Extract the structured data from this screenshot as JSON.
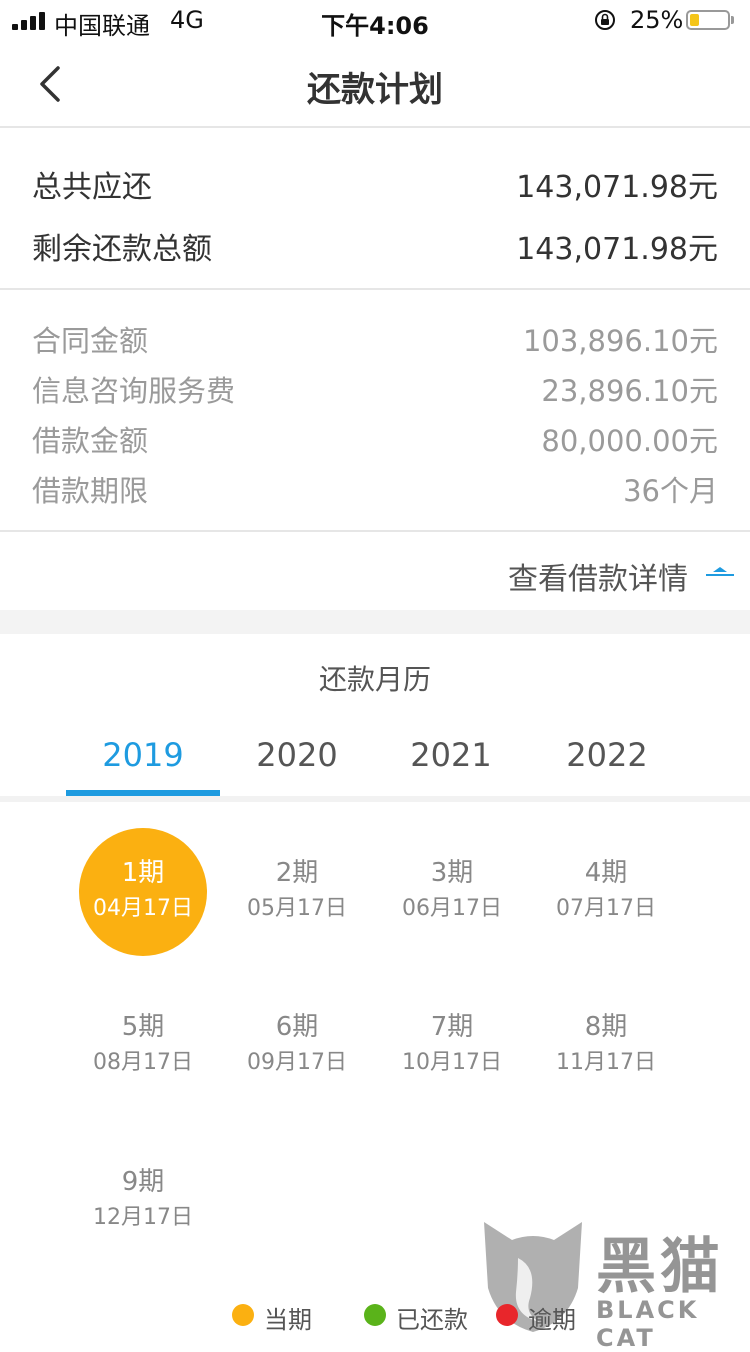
{
  "status_bar": {
    "carrier": "中国联通",
    "network": "4G",
    "time": "下午4:06",
    "battery_percent": "25%",
    "battery_level": 0.25,
    "battery_color": "#f5c518"
  },
  "nav": {
    "title": "还款计划",
    "back_icon": "chevron-left-icon"
  },
  "summary": {
    "total_due_label": "总共应还",
    "total_due_value": "143,071.98元",
    "remaining_label": "剩余还款总额",
    "remaining_value": "143,071.98元"
  },
  "details": {
    "contract_label": "合同金额",
    "contract_value": "103,896.10元",
    "fee_label": "信息咨询服务费",
    "fee_value": "23,896.10元",
    "loan_label": "借款金额",
    "loan_value": "80,000.00元",
    "term_label": "借款期限",
    "term_value": "36个月"
  },
  "view_detail": {
    "label": "查看借款详情",
    "icon": "caret-up-icon"
  },
  "calendar": {
    "title": "还款月历",
    "years": [
      "2019",
      "2020",
      "2021",
      "2022"
    ],
    "active_year": "2019",
    "accent_color": "#1e9be0",
    "periods": [
      {
        "num": "1期",
        "date": "04月17日",
        "status": "current"
      },
      {
        "num": "2期",
        "date": "05月17日",
        "status": "upcoming"
      },
      {
        "num": "3期",
        "date": "06月17日",
        "status": "upcoming"
      },
      {
        "num": "4期",
        "date": "07月17日",
        "status": "upcoming"
      },
      {
        "num": "5期",
        "date": "08月17日",
        "status": "upcoming"
      },
      {
        "num": "6期",
        "date": "09月17日",
        "status": "upcoming"
      },
      {
        "num": "7期",
        "date": "10月17日",
        "status": "upcoming"
      },
      {
        "num": "8期",
        "date": "11月17日",
        "status": "upcoming"
      },
      {
        "num": "9期",
        "date": "12月17日",
        "status": "upcoming"
      }
    ]
  },
  "legend": {
    "current_label": "当期",
    "current_color": "#fbb011",
    "paid_label": "已还款",
    "paid_color": "#5ab31a",
    "overdue_label": "逾期",
    "overdue_color": "#e8262b"
  },
  "watermark": {
    "text": "黑猫",
    "sub": "BLACK CAT"
  }
}
